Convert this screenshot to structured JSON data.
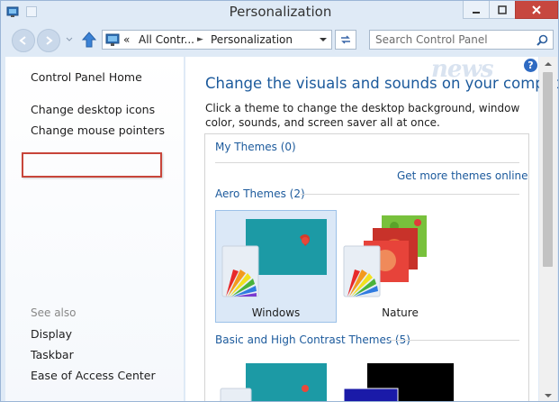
{
  "window": {
    "title": "Personalization"
  },
  "address": {
    "crumb_more": "«",
    "crumb1": "All Contr...",
    "separator": "►",
    "crumb2": "Personalization"
  },
  "search": {
    "placeholder": "Search Control Panel"
  },
  "sidebar": {
    "home": "Control Panel Home",
    "items": [
      "Change desktop icons",
      "Change mouse pointers"
    ],
    "see_also": "See also",
    "see_also_items": [
      "Display",
      "Taskbar",
      "Ease of Access Center"
    ]
  },
  "main": {
    "heading": "Change the visuals and sounds on your computer",
    "description": "Click a theme to change the desktop background, window color, sounds, and screen saver all at once.",
    "my_themes": "My Themes (0)",
    "get_more": "Get more themes online",
    "aero_themes": "Aero Themes (2)",
    "themes": [
      {
        "name": "Windows",
        "selected": true
      },
      {
        "name": "Nature",
        "selected": false
      }
    ],
    "basic_themes": "Basic and High Contrast Themes (5)"
  },
  "watermark": "news",
  "help_label": "?",
  "colors": {
    "accent": "#1c5a9c",
    "highlight": "#c8453a",
    "window_frame": "#dfeaf6",
    "close_button": "#c7473f"
  }
}
